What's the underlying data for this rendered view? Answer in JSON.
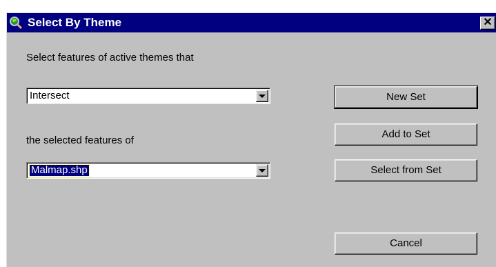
{
  "window": {
    "title": "Select By Theme",
    "close_glyph": "✕",
    "title_icon": "magnifier-globe-icon"
  },
  "labels": {
    "prompt": "Select features of active themes that",
    "selected_of": "the selected features of"
  },
  "combos": {
    "relation": {
      "value": "Intersect"
    },
    "theme": {
      "value": "Malmap.shp"
    }
  },
  "buttons": {
    "new_set": "New Set",
    "add_to_set": "Add to Set",
    "select_from_set": "Select from Set",
    "cancel": "Cancel"
  },
  "colors": {
    "titlebar": "#000080",
    "face": "#c0c0c0",
    "highlight": "#000080"
  }
}
